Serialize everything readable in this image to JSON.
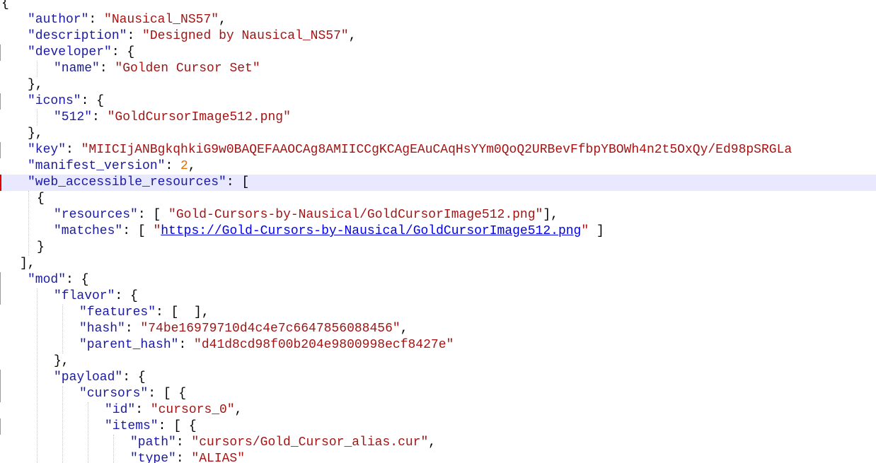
{
  "lines": [
    {
      "tokens": [
        [
          "p",
          "{"
        ]
      ]
    },
    {
      "tokens": [
        [
          "k",
          "\"author\""
        ],
        [
          "p",
          ": "
        ],
        [
          "s",
          "\"Nausical_NS57\""
        ],
        [
          "p",
          ","
        ]
      ]
    },
    {
      "tokens": [
        [
          "k",
          "\"description\""
        ],
        [
          "p",
          ": "
        ],
        [
          "s",
          "\"Designed by Nausical_NS57\""
        ],
        [
          "p",
          ","
        ]
      ]
    },
    {
      "tokens": [
        [
          "k",
          "\"developer\""
        ],
        [
          "p",
          ": {"
        ]
      ]
    },
    {
      "tokens": [
        [
          "k",
          "\"name\""
        ],
        [
          "p",
          ": "
        ],
        [
          "s",
          "\"Golden Cursor Set\""
        ]
      ]
    },
    {
      "tokens": [
        [
          "p",
          "},"
        ]
      ]
    },
    {
      "tokens": [
        [
          "k",
          "\"icons\""
        ],
        [
          "p",
          ": {"
        ]
      ]
    },
    {
      "tokens": [
        [
          "k",
          "\"512\""
        ],
        [
          "p",
          ": "
        ],
        [
          "s",
          "\"GoldCursorImage512.png\""
        ]
      ]
    },
    {
      "tokens": [
        [
          "p",
          "},"
        ]
      ]
    },
    {
      "tokens": [
        [
          "k",
          "\"key\""
        ],
        [
          "p",
          ": "
        ],
        [
          "s",
          "\"MIICIjANBgkqhkiG9w0BAQEFAAOCAg8AMIICCgKCAgEAuCAqHsYYm0QoQ2URBevFfbpYBOWh4n2t5OxQy/Ed98pSRGLa"
        ]
      ]
    },
    {
      "tokens": [
        [
          "k",
          "\"manifest_version\""
        ],
        [
          "p",
          ": "
        ],
        [
          "n",
          "2"
        ],
        [
          "p",
          ","
        ]
      ]
    },
    {
      "tokens": [
        [
          "k",
          "\"web_accessible_resources\""
        ],
        [
          "p",
          ": ["
        ]
      ]
    },
    {
      "tokens": [
        [
          "p",
          "{"
        ]
      ]
    },
    {
      "tokens": [
        [
          "k",
          "\"resources\""
        ],
        [
          "p",
          ": [ "
        ],
        [
          "s",
          "\"Gold-Cursors-by-Nausical/GoldCursorImage512.png\""
        ],
        [
          "p",
          "],"
        ]
      ]
    },
    {
      "tokens": [
        [
          "k",
          "\"matches\""
        ],
        [
          "p",
          ": [ "
        ],
        [
          "s",
          "\""
        ],
        [
          "u",
          "https://Gold-Cursors-by-Nausical/GoldCursorImage512.png"
        ],
        [
          "s",
          "\""
        ],
        [
          "p",
          " ]"
        ]
      ]
    },
    {
      "tokens": [
        [
          "p",
          "}"
        ]
      ]
    },
    {
      "tokens": [
        [
          "p",
          "],"
        ]
      ]
    },
    {
      "tokens": [
        [
          "k",
          "\"mod\""
        ],
        [
          "p",
          ": {"
        ]
      ]
    },
    {
      "tokens": [
        [
          "k",
          "\"flavor\""
        ],
        [
          "p",
          ": {"
        ]
      ]
    },
    {
      "tokens": [
        [
          "k",
          "\"features\""
        ],
        [
          "p",
          ": [  ],"
        ]
      ]
    },
    {
      "tokens": [
        [
          "k",
          "\"hash\""
        ],
        [
          "p",
          ": "
        ],
        [
          "s",
          "\"74be16979710d4c4e7c6647856088456\""
        ],
        [
          "p",
          ","
        ]
      ]
    },
    {
      "tokens": [
        [
          "k",
          "\"parent_hash\""
        ],
        [
          "p",
          ": "
        ],
        [
          "s",
          "\"d41d8cd98f00b204e9800998ecf8427e\""
        ]
      ]
    },
    {
      "tokens": [
        [
          "p",
          "},"
        ]
      ]
    },
    {
      "tokens": [
        [
          "k",
          "\"payload\""
        ],
        [
          "p",
          ": {"
        ]
      ]
    },
    {
      "tokens": [
        [
          "k",
          "\"cursors\""
        ],
        [
          "p",
          ": [ {"
        ]
      ]
    },
    {
      "tokens": [
        [
          "k",
          "\"id\""
        ],
        [
          "p",
          ": "
        ],
        [
          "s",
          "\"cursors_0\""
        ],
        [
          "p",
          ","
        ]
      ]
    },
    {
      "tokens": [
        [
          "k",
          "\"items\""
        ],
        [
          "p",
          ": [ {"
        ]
      ]
    },
    {
      "tokens": [
        [
          "k",
          "\"path\""
        ],
        [
          "p",
          ": "
        ],
        [
          "s",
          "\"cursors/Gold_Cursor_alias.cur\""
        ],
        [
          "p",
          ","
        ]
      ]
    },
    {
      "tokens": [
        [
          "k",
          "\"type\""
        ],
        [
          "p",
          ": "
        ],
        [
          "s",
          "\"ALIAS\""
        ]
      ]
    }
  ]
}
